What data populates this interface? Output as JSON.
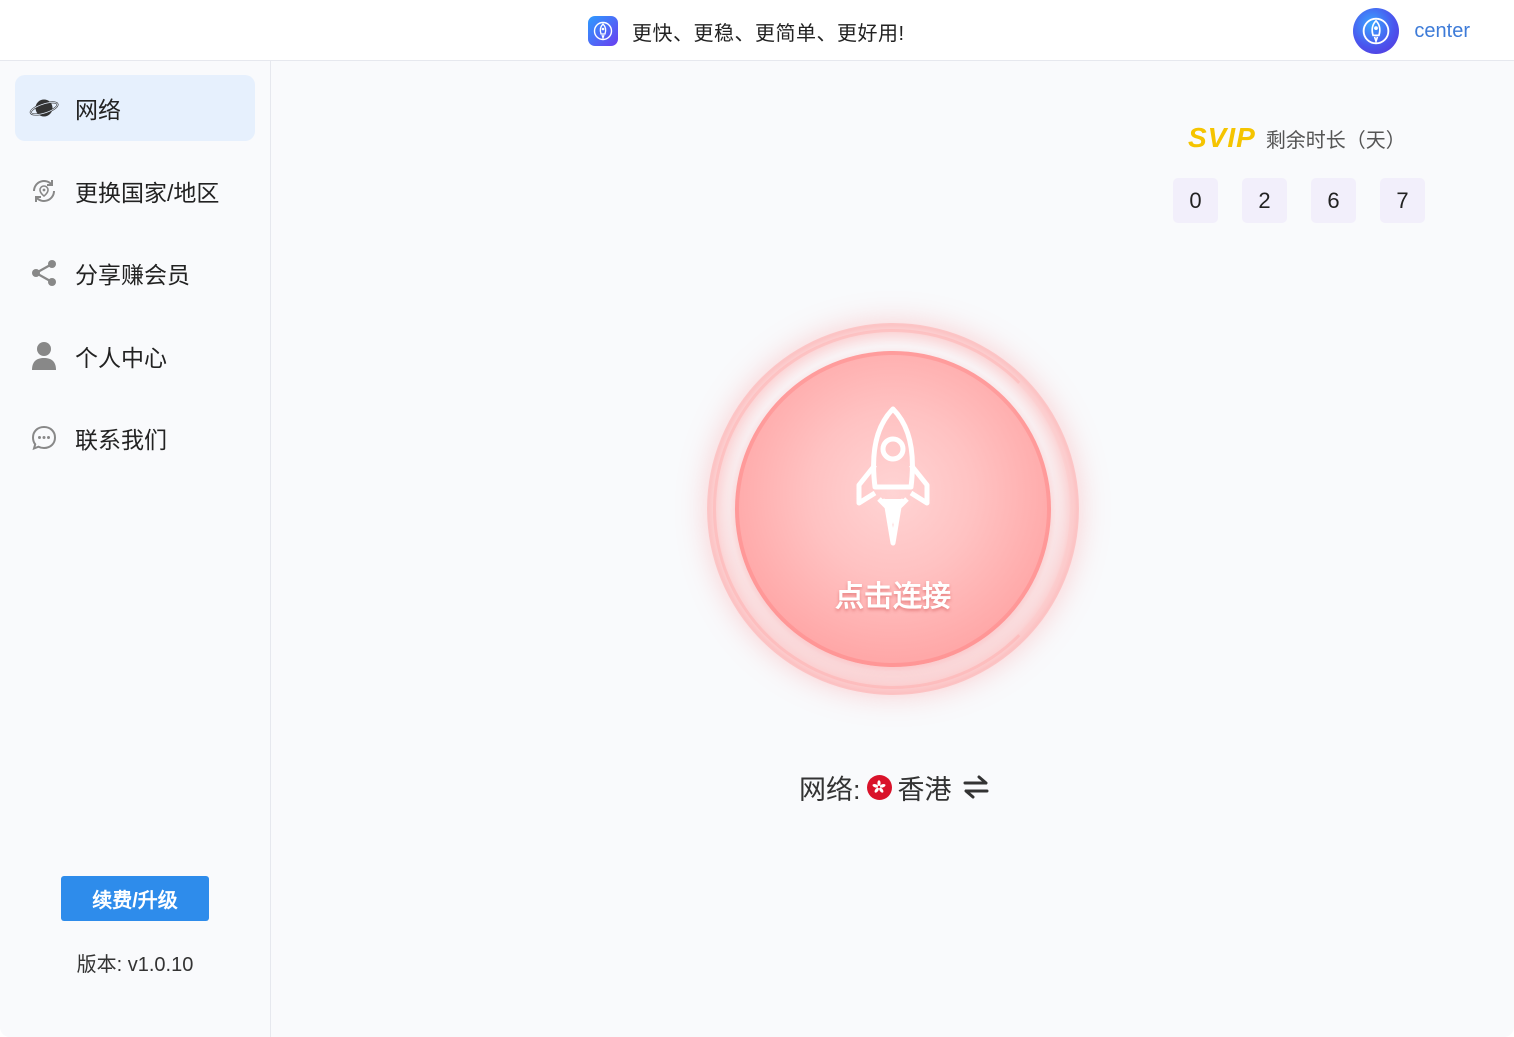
{
  "header": {
    "slogan": "更快、更稳、更简单、更好用!",
    "username": "center"
  },
  "sidebar": {
    "items": [
      {
        "label": "网络",
        "icon": "planet-icon",
        "active": true
      },
      {
        "label": "更换国家/地区",
        "icon": "refresh-location-icon",
        "active": false
      },
      {
        "label": "分享赚会员",
        "icon": "share-icon",
        "active": false
      },
      {
        "label": "个人中心",
        "icon": "user-icon",
        "active": false
      },
      {
        "label": "联系我们",
        "icon": "chat-icon",
        "active": false
      }
    ],
    "renew_label": "续费/升级",
    "version": "版本: v1.0.10"
  },
  "membership": {
    "badge": "SVIP",
    "remaining_label": "剩余时长（天）",
    "digits": [
      "0",
      "2",
      "6",
      "7"
    ]
  },
  "connect": {
    "label": "点击连接"
  },
  "network": {
    "label": "网络:",
    "region": "香港"
  },
  "colors": {
    "accent": "#2e8ceb",
    "svip": "#f5c400",
    "connect": "#ff9e9e",
    "active_nav": "#e6f0fd"
  }
}
